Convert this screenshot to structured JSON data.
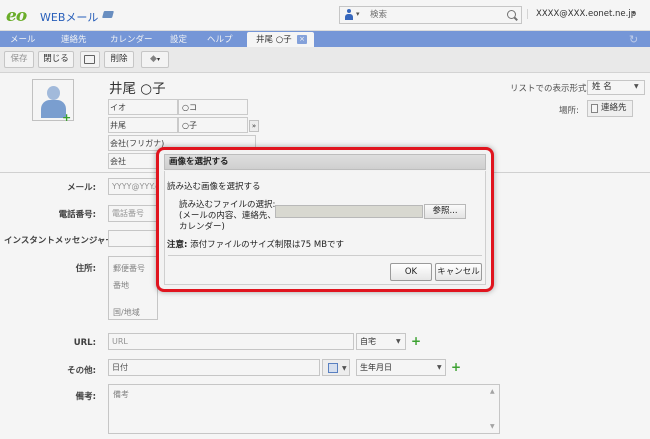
{
  "header": {
    "logo": "eo",
    "app_name": "WEBメール",
    "search": {
      "scope": "▾",
      "placeholder": "検索"
    },
    "account": "XXXX@XXX.eonet.ne.jp",
    "account_menu": "▾"
  },
  "nav": {
    "items": [
      "メール",
      "連絡先",
      "カレンダー",
      "設定",
      "ヘルプ"
    ],
    "active_tab": "井尾 ○子",
    "close": "×",
    "refresh": "↻"
  },
  "toolbar": {
    "save": "保存",
    "close": "閉じる",
    "delete": "削除",
    "tag": "▾"
  },
  "contact": {
    "name": "井尾 ○子",
    "fields": {
      "kana_last_label": "イオ",
      "kana_first_value": "○コ",
      "last_label": "井尾",
      "first_value": "○子",
      "expand": "»",
      "company_kana_label": "会社(フリガナ)",
      "company_label": "会社"
    },
    "display_label": "リストでの表示形式:",
    "display_value": "姓 名",
    "place_label": "場所:",
    "place_value": "連絡先"
  },
  "form": {
    "email_label": "メール:",
    "email_placeholder": "YYYY@YYY.ea",
    "phone_label": "電話番号:",
    "phone_placeholder": "電話番号",
    "im_label": "インスタントメッセンジャー:",
    "address_label": "住所:",
    "zip_placeholder": "郵便番号",
    "street_placeholder": "番地",
    "country_placeholder": "国/地域",
    "url_label": "URL:",
    "url_placeholder": "URL",
    "url_type": "自宅",
    "other_label": "その他:",
    "other_placeholder": "日付",
    "other_type": "生年月日",
    "note_label": "備考:",
    "note_placeholder": "備考"
  },
  "dialog": {
    "title": "画像を選択する",
    "heading": "読み込む画像を選択する",
    "file_label_1": "読み込むファイルの選択:",
    "file_label_2": "(メールの内容、連絡先、",
    "file_label_3": "カレンダー)",
    "browse": "参照...",
    "note_prefix": "注意:",
    "note_text": " 添付ファイルのサイズ制限は75 MBです",
    "ok": "OK",
    "cancel": "キャンセル"
  },
  "colors": {
    "nav_bg": "#7a9de0",
    "accent_green": "#3ea832",
    "dialog_highlight": "#e0141e"
  }
}
